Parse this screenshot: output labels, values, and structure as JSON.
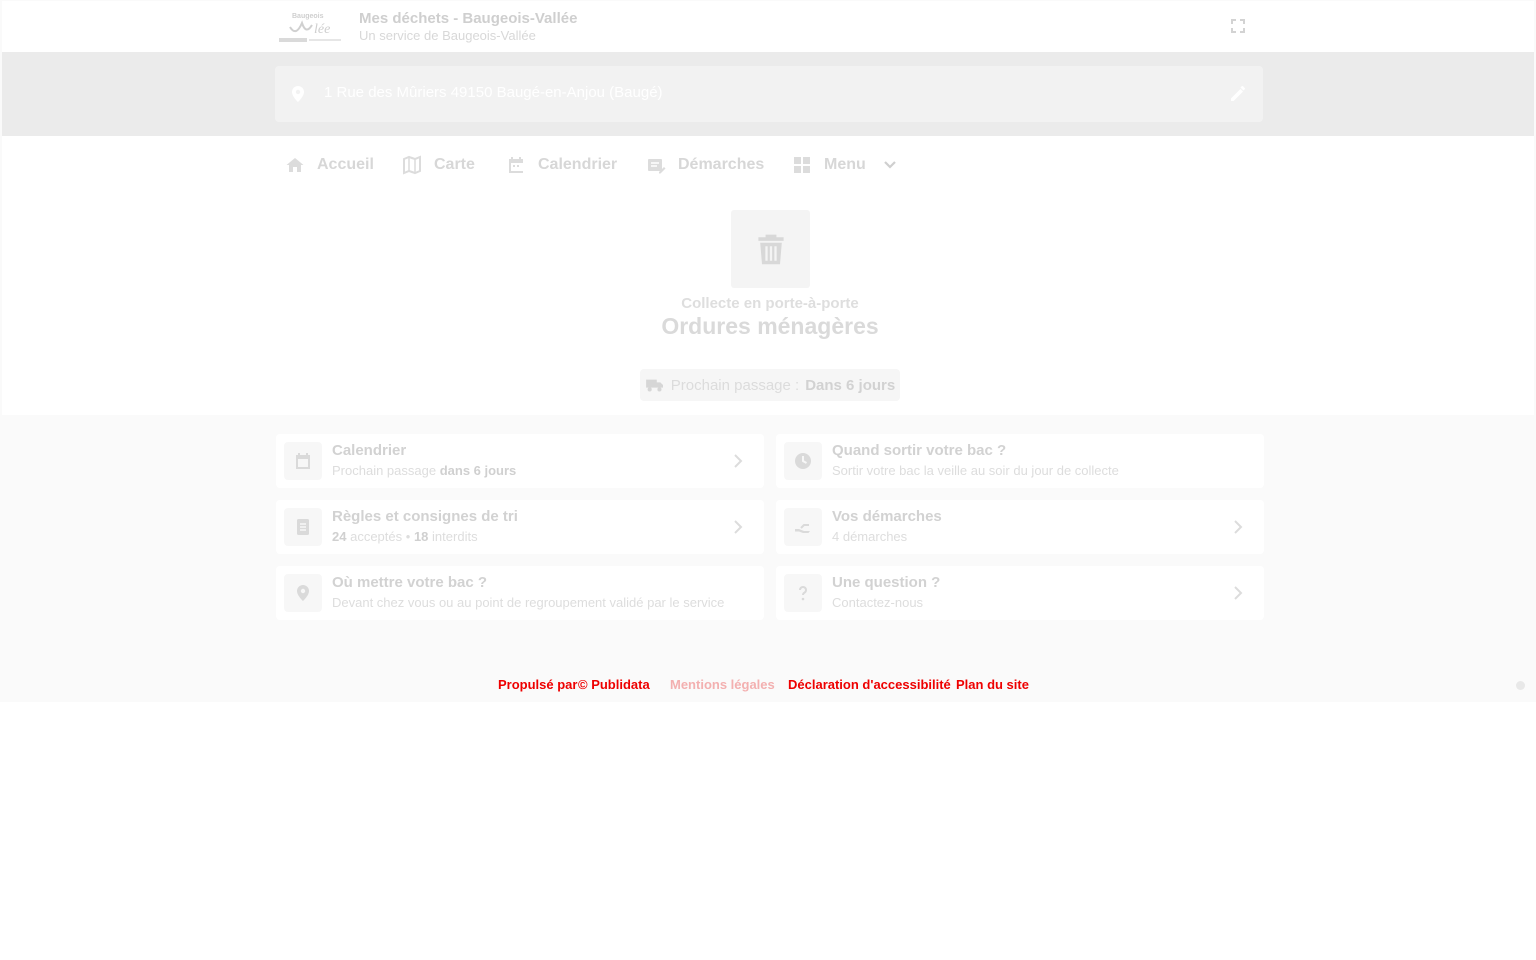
{
  "header": {
    "title": "Mes déchets - Baugeois-Vallée",
    "subtitle": "Un service de Baugeois-Vallée",
    "logo_name": "Baugeois Vallée",
    "fullscreen_icon": "fullscreen-icon"
  },
  "address": {
    "value": "1 Rue des Mûriers 49150 Baugé-en-Anjou (Baugé)",
    "pin_icon": "map-pin-icon",
    "edit_icon": "pencil-icon"
  },
  "nav": {
    "items": [
      {
        "label": "Accueil",
        "icon": "home-icon"
      },
      {
        "label": "Carte",
        "icon": "map-icon"
      },
      {
        "label": "Calendrier",
        "icon": "calendar-icon"
      },
      {
        "label": "Démarches",
        "icon": "form-icon"
      },
      {
        "label": "Menu",
        "icon": "grid-icon"
      }
    ]
  },
  "hero": {
    "icon": "trash-icon",
    "kicker": "Collecte en porte-à-porte",
    "title": "Ordures ménagères",
    "next_label": "Prochain passage :",
    "next_value": "Dans 6 jours"
  },
  "cards": [
    {
      "title": "Calendrier",
      "sub_prefix": "Prochain passage",
      "sub_bold": "dans 6 jours",
      "icon": "calendar-icon"
    },
    {
      "title": "Quand sortir votre bac ?",
      "sub": "Sortir votre bac la veille au soir du jour de collecte",
      "icon": "clock-icon"
    },
    {
      "title": "Règles et consignes de tri",
      "accepted_count": "24",
      "accepted_label": "acceptés",
      "separator": "•",
      "forbidden_count": "18",
      "forbidden_label": "interdits",
      "icon": "list-icon"
    },
    {
      "title": "Vos démarches",
      "sub": "4 démarches",
      "icon": "hand-icon"
    },
    {
      "title": "Où mettre votre bac ?",
      "sub": "Devant chez vous ou au point de regroupement validé par le service",
      "icon": "map-pin-icon"
    },
    {
      "title": "Une question ?",
      "sub": "Contactez-nous",
      "icon": "question-icon"
    }
  ],
  "footer": {
    "links": [
      "Propulsé par",
      "© Publidata",
      "Mentions légales",
      "Déclaration d'accessibilité",
      "Plan du site"
    ],
    "color": "#ee0000"
  }
}
